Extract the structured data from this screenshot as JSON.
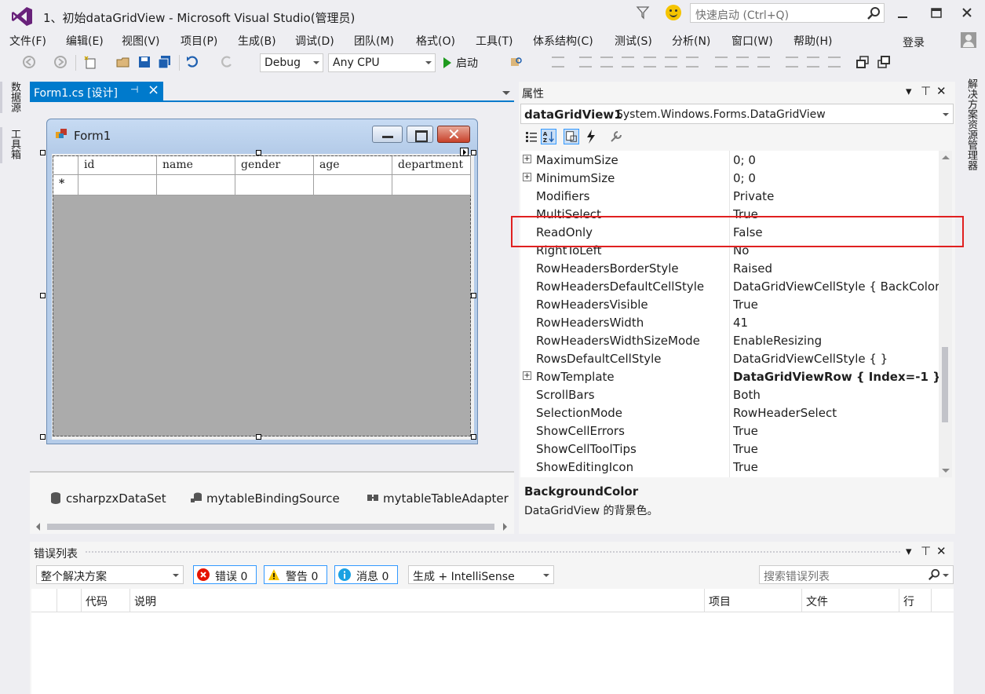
{
  "window": {
    "title": "1、初始dataGridView - Microsoft Visual Studio(管理员)",
    "quick_launch_placeholder": "快速启动 (Ctrl+Q)",
    "login": "登录"
  },
  "menu": [
    "文件(F)",
    "编辑(E)",
    "视图(V)",
    "项目(P)",
    "生成(B)",
    "调试(D)",
    "团队(M)",
    "格式(O)",
    "工具(T)",
    "体系结构(C)",
    "测试(S)",
    "分析(N)",
    "窗口(W)",
    "帮助(H)"
  ],
  "toolbar": {
    "config": "Debug",
    "platform": "Any CPU",
    "start_label": "启动"
  },
  "left_tabs": [
    "数据源",
    "工具箱"
  ],
  "right_tab": "解决方案资源管理器",
  "document": {
    "tab_label": "Form1.cs [设计]",
    "form_title": "Form1",
    "grid_columns": [
      "id",
      "name",
      "gender",
      "age",
      "department"
    ],
    "new_row_marker": "*"
  },
  "tray": [
    "csharpzxDataSet",
    "mytableBindingSource",
    "mytableTableAdapter"
  ],
  "properties": {
    "panel_title": "属性",
    "object_name": "dataGridView1",
    "object_type": "System.Windows.Forms.DataGridView",
    "rows": [
      {
        "name": "MaximumSize",
        "value": "0; 0",
        "expandable": true,
        "bold": false
      },
      {
        "name": "MinimumSize",
        "value": "0; 0",
        "expandable": true,
        "bold": false
      },
      {
        "name": "Modifiers",
        "value": "Private",
        "expandable": false,
        "bold": false
      },
      {
        "name": "MultiSelect",
        "value": "True",
        "expandable": false,
        "bold": false
      },
      {
        "name": "ReadOnly",
        "value": "False",
        "expandable": false,
        "bold": false
      },
      {
        "name": "RightToLeft",
        "value": "No",
        "expandable": false,
        "bold": false
      },
      {
        "name": "RowHeadersBorderStyle",
        "value": "Raised",
        "expandable": false,
        "bold": false
      },
      {
        "name": "RowHeadersDefaultCellStyle",
        "value": "DataGridViewCellStyle { BackColor=",
        "expandable": false,
        "bold": false
      },
      {
        "name": "RowHeadersVisible",
        "value": "True",
        "expandable": false,
        "bold": false
      },
      {
        "name": "RowHeadersWidth",
        "value": "41",
        "expandable": false,
        "bold": false
      },
      {
        "name": "RowHeadersWidthSizeMode",
        "value": "EnableResizing",
        "expandable": false,
        "bold": false
      },
      {
        "name": "RowsDefaultCellStyle",
        "value": "DataGridViewCellStyle { }",
        "expandable": false,
        "bold": false
      },
      {
        "name": "RowTemplate",
        "value": "DataGridViewRow { Index=-1 }",
        "expandable": true,
        "bold": true
      },
      {
        "name": "ScrollBars",
        "value": "Both",
        "expandable": false,
        "bold": false
      },
      {
        "name": "SelectionMode",
        "value": "RowHeaderSelect",
        "expandable": false,
        "bold": false
      },
      {
        "name": "ShowCellErrors",
        "value": "True",
        "expandable": false,
        "bold": false
      },
      {
        "name": "ShowCellToolTips",
        "value": "True",
        "expandable": false,
        "bold": false
      },
      {
        "name": "ShowEditingIcon",
        "value": "True",
        "expandable": false,
        "bold": false
      }
    ],
    "desc_title": "BackgroundColor",
    "desc_text": "DataGridView 的背景色。"
  },
  "error_list": {
    "title": "错误列表",
    "scope": "整个解决方案",
    "errors_label": "错误 0",
    "warnings_label": "警告 0",
    "messages_label": "消息 0",
    "build_filter": "生成 + IntelliSense",
    "search_placeholder": "搜索错误列表",
    "columns": [
      "代码",
      "说明",
      "项目",
      "文件",
      "行"
    ]
  },
  "colors": {
    "accent": "#007acc",
    "highlight": "#e02020",
    "grid_bg": "#ababab"
  }
}
